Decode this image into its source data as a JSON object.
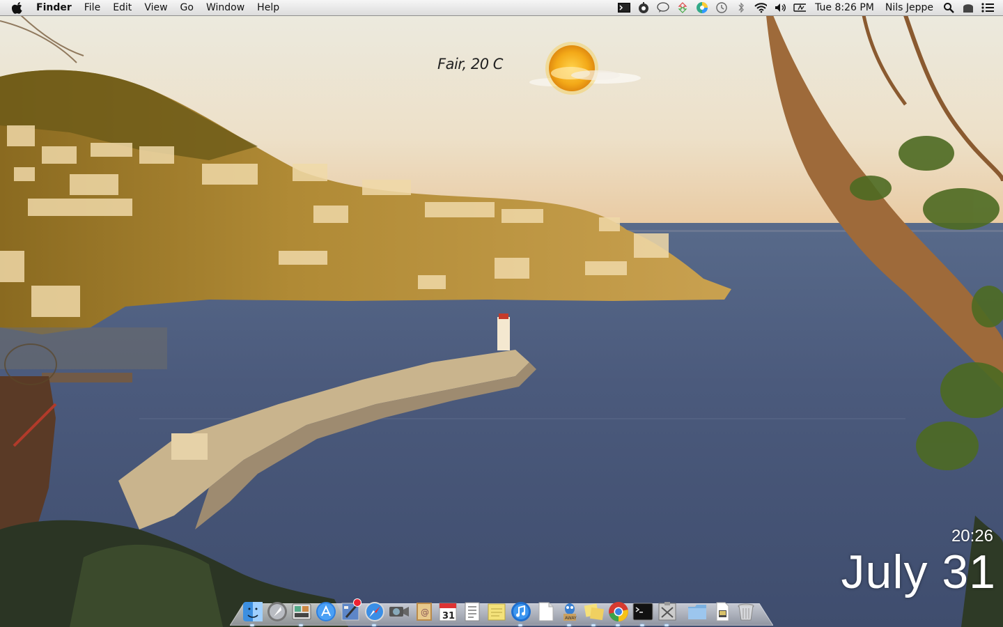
{
  "menubar": {
    "app_name": "Finder",
    "menus": [
      "File",
      "Edit",
      "View",
      "Go",
      "Window",
      "Help"
    ],
    "clock": "Tue 8:26 PM",
    "user": "Nils Jeppe",
    "status_icons": [
      "terminal-icon",
      "gauge-icon",
      "chat-bubble-icon",
      "transfer-icon",
      "color-wheel-icon",
      "time-machine-icon",
      "bluetooth-icon",
      "wifi-icon",
      "volume-icon",
      "battery-icon"
    ]
  },
  "weather": {
    "text": "Fair, 20 C",
    "icon": "sun-cloud-icon"
  },
  "clock_widget": {
    "time": "20:26",
    "date": "July 31"
  },
  "dock": {
    "apps": [
      "finder",
      "launchpad",
      "photo-booth",
      "app-store",
      "xcode",
      "safari",
      "facetime",
      "contacts",
      "calendar",
      "reminders",
      "notes",
      "itunes",
      "text-document",
      "adium",
      "stickies",
      "chrome",
      "terminal",
      "network-utility"
    ],
    "calendar_day": "31",
    "right_items": [
      "applications-folder",
      "documents-stack",
      "trash"
    ]
  },
  "colors": {
    "sky_top": "#e9ddc6",
    "sky_bottom": "#eac9a0",
    "sea": "#4a5878",
    "hill_sunlit": "#c8922e",
    "menubar": "#e8e8e8"
  }
}
